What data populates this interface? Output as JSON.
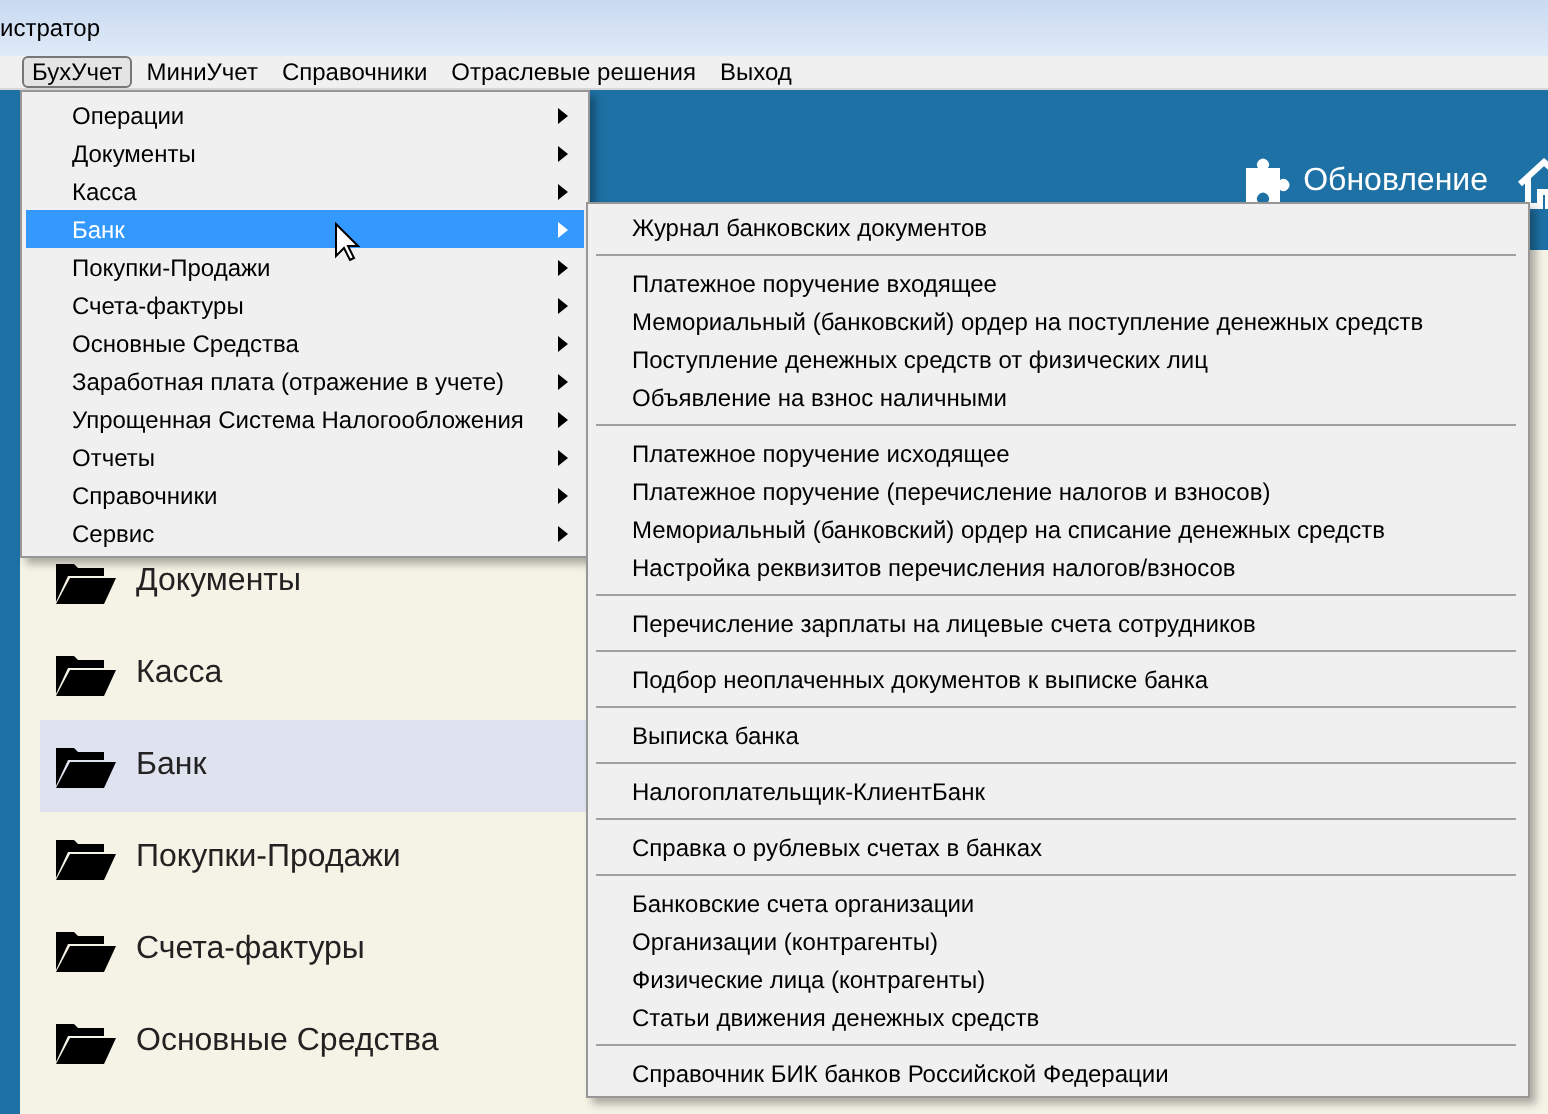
{
  "window": {
    "title": "истратор"
  },
  "menubar": [
    {
      "label": "БухУчет",
      "selected": true
    },
    {
      "label": "МиниУчет",
      "selected": false
    },
    {
      "label": "Справочники",
      "selected": false
    },
    {
      "label": "Отраслевые решения",
      "selected": false
    },
    {
      "label": "Выход",
      "selected": false
    }
  ],
  "header": {
    "buttons": [
      {
        "label": "Обновление",
        "kind": "puzzle"
      },
      {
        "kind": "home"
      }
    ]
  },
  "dropdown": [
    {
      "label": "Операции",
      "selected": false,
      "has_submenu": true
    },
    {
      "label": "Документы",
      "selected": false,
      "has_submenu": true
    },
    {
      "label": "Касса",
      "selected": false,
      "has_submenu": true
    },
    {
      "label": "Банк",
      "selected": true,
      "has_submenu": true
    },
    {
      "label": "Покупки-Продажи",
      "selected": false,
      "has_submenu": true
    },
    {
      "label": "Счета-фактуры",
      "selected": false,
      "has_submenu": true
    },
    {
      "label": "Основные Средства",
      "selected": false,
      "has_submenu": true
    },
    {
      "label": "Заработная плата (отражение в учете)",
      "selected": false,
      "has_submenu": true
    },
    {
      "label": "Упрощенная Система Налогообложения",
      "selected": false,
      "has_submenu": true
    },
    {
      "label": "Отчеты",
      "selected": false,
      "has_submenu": true
    },
    {
      "label": "Справочники",
      "selected": false,
      "has_submenu": true
    },
    {
      "label": "Сервис",
      "selected": false,
      "has_submenu": true
    }
  ],
  "submenu": [
    [
      "Журнал банковских документов"
    ],
    [
      "Платежное поручение входящее",
      "Мемориальный (банковский) ордер на поступление денежных средств",
      "Поступление денежных средств от физических лиц",
      "Объявление на взнос наличными"
    ],
    [
      "Платежное поручение исходящее",
      "Платежное поручение (перечисление налогов и взносов)",
      "Мемориальный (банковский) ордер на списание денежных средств",
      "Настройка реквизитов перечисления налогов/взносов"
    ],
    [
      "Перечисление зарплаты на лицевые счета сотрудников"
    ],
    [
      "Подбор неоплаченных документов к выписке банка"
    ],
    [
      "Выписка банка"
    ],
    [
      "Налогоплательщик-КлиентБанк"
    ],
    [
      "Справка о рублевых счетах в банках"
    ],
    [
      "Банковские счета организации",
      "Организации (контрагенты)",
      "Физические лица (контрагенты)",
      "Статьи движения денежных средств"
    ],
    [
      "Справочник БИК банков Российской Федерации"
    ]
  ],
  "sidebar": {
    "items": [
      {
        "label": "Документы",
        "selected": false
      },
      {
        "label": "Касса",
        "selected": false
      },
      {
        "label": "Банк",
        "selected": true
      },
      {
        "label": "Покупки-Продажи",
        "selected": false
      },
      {
        "label": "Счета-фактуры",
        "selected": false
      },
      {
        "label": "Основные Средства",
        "selected": false
      }
    ]
  }
}
